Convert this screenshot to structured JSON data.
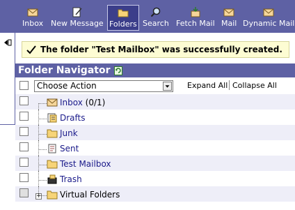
{
  "toolbar": {
    "items": [
      {
        "label": "Inbox",
        "icon": "envelope-icon"
      },
      {
        "label": "New Message",
        "icon": "compose-icon"
      },
      {
        "label": "Folders",
        "icon": "folder-icon",
        "active": true
      },
      {
        "label": "Search",
        "icon": "magnifier-icon"
      },
      {
        "label": "Fetch Mail",
        "icon": "fetch-mail-icon"
      },
      {
        "label": "Mail",
        "icon": "envelope-icon"
      },
      {
        "label": "Dynamic Mail",
        "icon": "envelope-icon"
      }
    ]
  },
  "notice": {
    "text": "The folder \"Test Mailbox\" was successfully created."
  },
  "navigator": {
    "title": "Folder Navigator",
    "action_select": "Choose Action",
    "expand_all": "Expand All",
    "collapse_all": "Collapse All",
    "folders": [
      {
        "name": "Inbox",
        "count": "(0/1)",
        "icon": "inbox-envelope-icon"
      },
      {
        "name": "Drafts",
        "icon": "drafts-icon"
      },
      {
        "name": "Junk",
        "icon": "folder-icon"
      },
      {
        "name": "Sent",
        "icon": "sent-icon"
      },
      {
        "name": "Test Mailbox",
        "icon": "folder-icon"
      },
      {
        "name": "Trash",
        "icon": "trash-icon"
      },
      {
        "name": "Virtual Folders",
        "icon": "folder-icon"
      }
    ]
  },
  "colors": {
    "toolbar": "#5e61a4",
    "notice_bg": "#fdfcd3",
    "link": "#1a1a8a"
  }
}
